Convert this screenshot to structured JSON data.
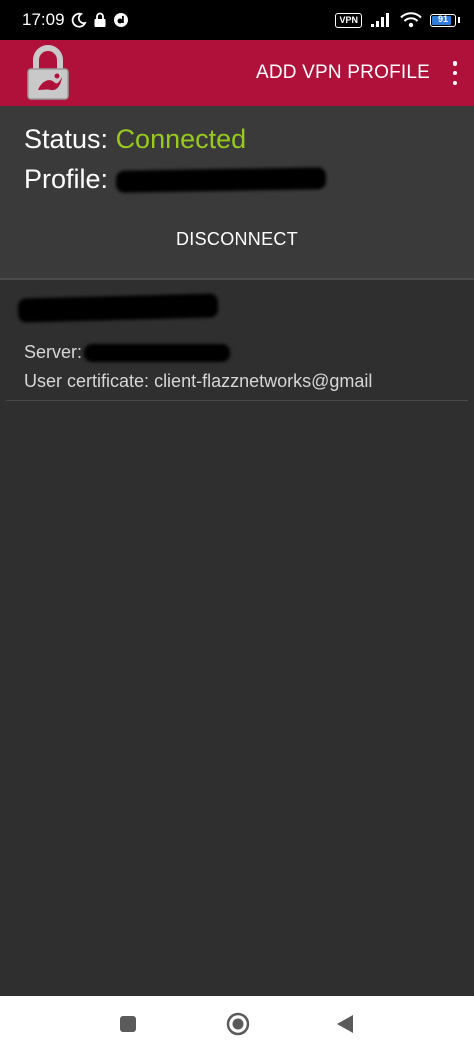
{
  "status_bar": {
    "time": "17:09",
    "vpn_badge": "VPN",
    "battery_level": "91",
    "icons": [
      "moon-icon",
      "lock-icon",
      "notification-icon",
      "vpn-icon",
      "signal-icon",
      "wifi-icon",
      "battery-icon"
    ]
  },
  "app_bar": {
    "logo_icon": "strongswan-lock-icon",
    "add_profile_label": "ADD VPN PROFILE",
    "menu_icon": "overflow-menu-icon",
    "color": "#b0113a"
  },
  "status_panel": {
    "status_label": "Status:",
    "status_value": "Connected",
    "status_color": "#97c91f",
    "profile_label": "Profile:",
    "disconnect_label": "DISCONNECT"
  },
  "profile_item": {
    "server_label": "Server:",
    "certificate_label": "User certificate:",
    "certificate_value": "client-flazznetworks@gmail"
  },
  "nav_bar": {
    "icons": [
      "recents-icon",
      "home-icon",
      "back-icon"
    ]
  }
}
